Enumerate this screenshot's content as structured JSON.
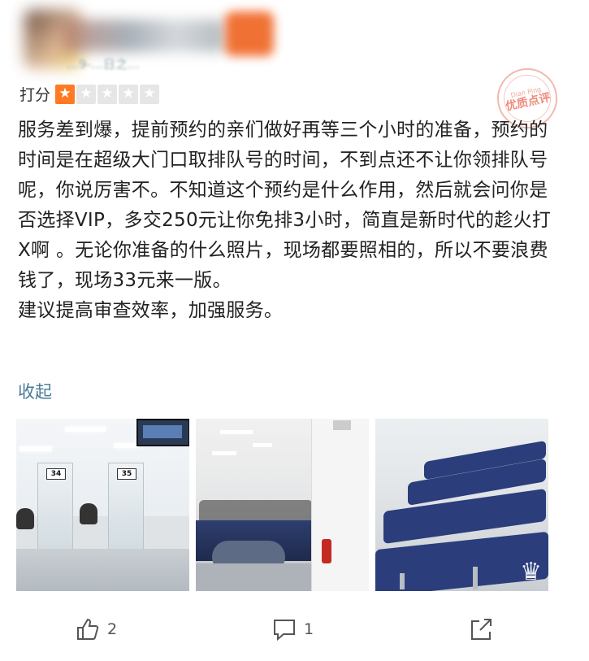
{
  "header": {
    "date_text": "…9-…日之…"
  },
  "rating": {
    "label": "打分",
    "stars_filled": 1,
    "stars_total": 5
  },
  "badge": {
    "top_text": "Dian Ping",
    "text": "优质点评"
  },
  "review": {
    "paragraph_1": "服务差到爆，提前预约的亲们做好再等三个小时的准备，预约的时间是在超级大门口取排队号的时间，不到点还不让你领排队号呢，你说厉害不。不知道这个预约是什么作用，然后就会问你是否选择VIP，多交250元让你免排3小时，简直是新时代的趁火打X啊 。无论你准备的什么照片，现场都要照相的，所以不要浪费钱了，现场33元来一版。",
    "paragraph_2": "建议提高审查效率，加强服务。",
    "collapse_label": "收起"
  },
  "photos": {
    "counter_numbers": [
      "34",
      "35"
    ]
  },
  "actions": {
    "like_count": "2",
    "comment_count": "1"
  },
  "colors": {
    "star_on": "#ff7a22",
    "star_off": "#e6e6e6",
    "link": "#4a7a96"
  }
}
